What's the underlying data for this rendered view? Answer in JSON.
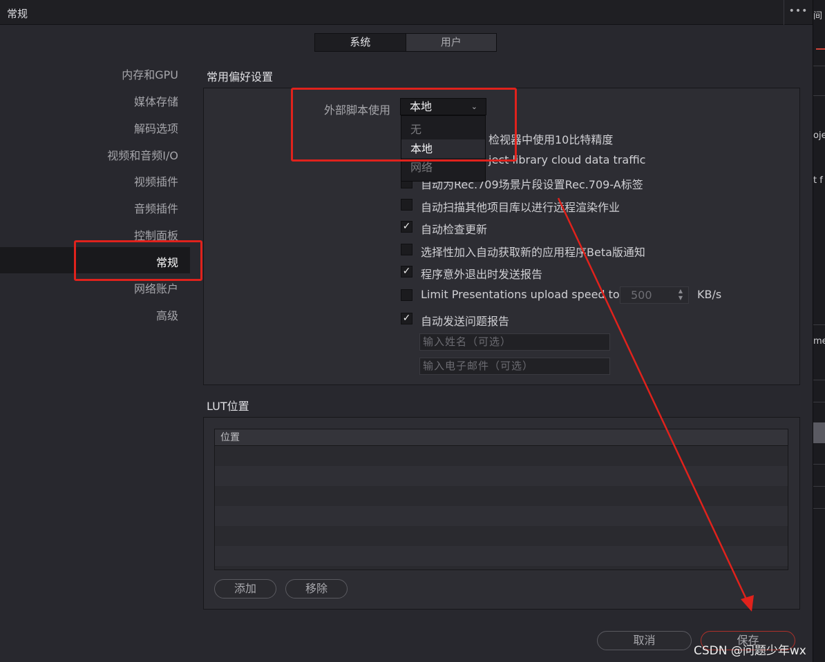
{
  "window": {
    "title": "常规",
    "more_icon": "ellipsis-icon",
    "more_glyph": "•••"
  },
  "tabs": [
    {
      "label": "系统"
    },
    {
      "label": "用户"
    }
  ],
  "sidebar": {
    "items": [
      {
        "label": "内存和GPU"
      },
      {
        "label": "媒体存储"
      },
      {
        "label": "解码选项"
      },
      {
        "label": "视频和音频I/O"
      },
      {
        "label": "视频插件"
      },
      {
        "label": "音频插件"
      },
      {
        "label": "控制面板"
      },
      {
        "label": "常规"
      },
      {
        "label": "网络账户"
      },
      {
        "label": "高级"
      }
    ],
    "selected": "常规"
  },
  "general": {
    "section_title": "常用偏好设置",
    "external_script": {
      "label": "外部脚本使用",
      "value": "本地",
      "options": [
        "无",
        "本地",
        "网络"
      ]
    },
    "options": [
      {
        "label": "检视器中使用10比特精度",
        "checked": false
      },
      {
        "label": "ject library cloud data traffic",
        "checked": false
      },
      {
        "label": "自动为Rec.709场景片段设置Rec.709-A标签",
        "checked": false
      },
      {
        "label": "自动扫描其他项目库以进行远程渲染作业",
        "checked": false
      },
      {
        "label": "自动检查更新",
        "checked": true
      },
      {
        "label": "选择性加入自动获取新的应用程序Beta版通知",
        "checked": false
      },
      {
        "label": "程序意外退出时发送报告",
        "checked": true
      },
      {
        "label": "Limit Presentations upload speed to",
        "checked": false
      },
      {
        "label": "自动发送问题报告",
        "checked": true
      }
    ],
    "upload_speed": {
      "value": "500",
      "unit": "KB/s"
    },
    "name_placeholder": "输入姓名（可选）",
    "email_placeholder": "输入电子邮件（可选）"
  },
  "lut": {
    "section_title": "LUT位置",
    "column_header": "位置",
    "add_label": "添加",
    "remove_label": "移除"
  },
  "footer": {
    "cancel_label": "取消",
    "save_label": "保存"
  },
  "background_app": {
    "fragments": [
      "间",
      "oje",
      "t f",
      "me"
    ]
  },
  "annotation": {
    "color": "#e0221c"
  },
  "watermark": "CSDN @问题少年wx"
}
